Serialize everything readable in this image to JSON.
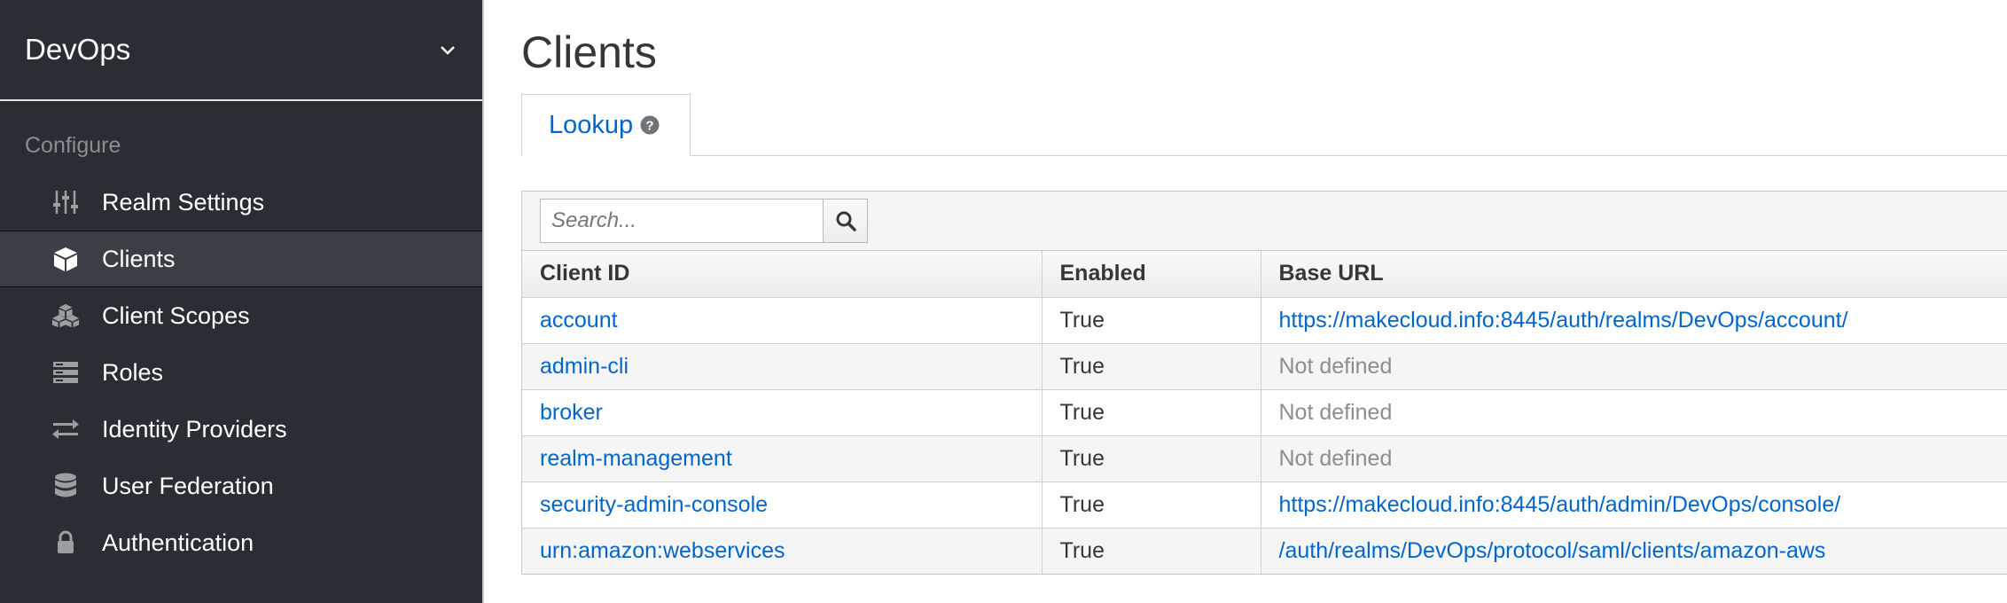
{
  "sidebar": {
    "realm_name": "DevOps",
    "section_label": "Configure",
    "items": [
      {
        "label": "Realm Settings",
        "icon": "sliders-icon"
      },
      {
        "label": "Clients",
        "icon": "cube-icon",
        "active": true
      },
      {
        "label": "Client Scopes",
        "icon": "cubes-icon"
      },
      {
        "label": "Roles",
        "icon": "roles-icon"
      },
      {
        "label": "Identity Providers",
        "icon": "exchange-icon"
      },
      {
        "label": "User Federation",
        "icon": "database-icon"
      },
      {
        "label": "Authentication",
        "icon": "lock-icon"
      }
    ]
  },
  "main": {
    "title": "Clients",
    "tab_label": "Lookup",
    "search_placeholder": "Search...",
    "columns": [
      "Client ID",
      "Enabled",
      "Base URL"
    ],
    "rows": [
      {
        "client_id": "account",
        "enabled": "True",
        "base_url": "https://makecloud.info:8445/auth/realms/DevOps/account/",
        "url_defined": true
      },
      {
        "client_id": "admin-cli",
        "enabled": "True",
        "base_url": "Not defined",
        "url_defined": false
      },
      {
        "client_id": "broker",
        "enabled": "True",
        "base_url": "Not defined",
        "url_defined": false
      },
      {
        "client_id": "realm-management",
        "enabled": "True",
        "base_url": "Not defined",
        "url_defined": false
      },
      {
        "client_id": "security-admin-console",
        "enabled": "True",
        "base_url": "https://makecloud.info:8445/auth/admin/DevOps/console/",
        "url_defined": true
      },
      {
        "client_id": "urn:amazon:webservices",
        "enabled": "True",
        "base_url": "/auth/realms/DevOps/protocol/saml/clients/amazon-aws",
        "url_defined": true
      }
    ]
  },
  "colors": {
    "sidebar_bg": "#292e34",
    "active_bg": "#393f44",
    "link": "#0066cc",
    "muted": "#8b8d8f"
  }
}
